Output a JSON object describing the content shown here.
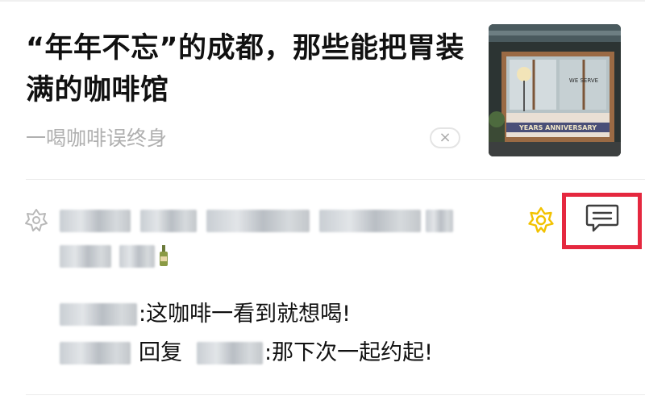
{
  "article": {
    "title": "“年年不忘”的成都，那些能把胃装满的咖啡馆",
    "source": "一喝咖啡误终身",
    "dismiss_label": "×",
    "thumbnail_text": "YEARS ANNIVERSARY",
    "thumbnail_sign": "WE SERVE"
  },
  "social": {
    "comments": [
      {
        "prefix": ":",
        "text": "这咖啡一看到就想喝!"
      },
      {
        "prefix": "回复",
        "text": "那下次一起约起!"
      }
    ],
    "reply_colon": ":"
  },
  "icons": {
    "friends": "friends-wow-outline-icon",
    "wow": "wow-icon",
    "comment": "comment-icon"
  },
  "colors": {
    "highlight": "#e5283f",
    "wow": "#f2c200",
    "muted": "#b0b0b0"
  }
}
